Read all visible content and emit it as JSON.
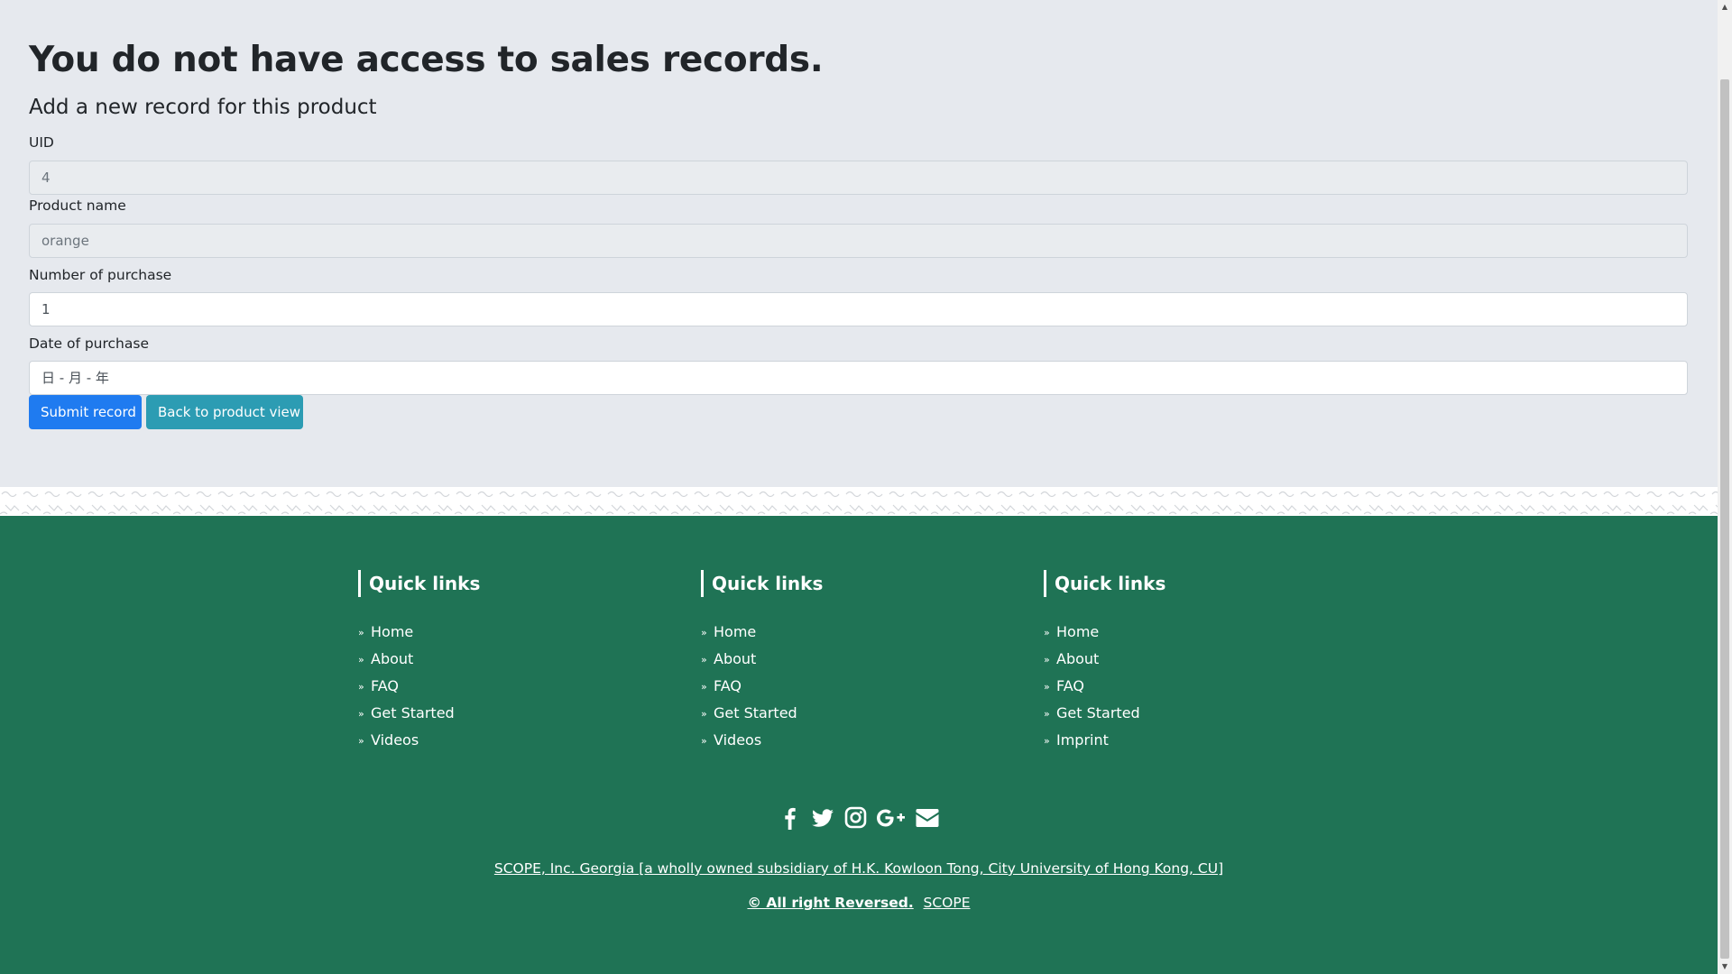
{
  "main": {
    "heading": "You do not have access to sales records.",
    "subheading": "Add a new record for this product",
    "form": {
      "uid_label": "UID",
      "uid_value": "4",
      "product_label": "Product name",
      "product_value": "orange",
      "quantity_label": "Number of purchase",
      "quantity_value": "1",
      "date_label": "Date of purchase",
      "date_value": "日 - 月 - 年",
      "submit_label": "Submit record",
      "back_label": "Back to product view"
    }
  },
  "footer": {
    "columns": [
      {
        "title": "Quick links",
        "links": [
          "Home",
          "About",
          "FAQ",
          "Get Started",
          "Videos"
        ]
      },
      {
        "title": "Quick links",
        "links": [
          "Home",
          "About",
          "FAQ",
          "Get Started",
          "Videos"
        ]
      },
      {
        "title": "Quick links",
        "links": [
          "Home",
          "About",
          "FAQ",
          "Get Started",
          "Imprint"
        ]
      }
    ],
    "social_icons": [
      "facebook-icon",
      "twitter-icon",
      "instagram-icon",
      "google-plus-icon",
      "envelope-icon"
    ],
    "company_text": "SCOPE, Inc. Georgia [a wholly owned subsidiary of H.K. Kowloon Tong, City University of Hong Kong, CU]",
    "copyright_text": "© All right Reversed.",
    "brand_link": "SCOPE"
  },
  "colors": {
    "page_background": "#e6e9ee",
    "footer_background": "#1f7355",
    "primary_button": "#1f7bf0",
    "info_button": "#2c9cb3"
  }
}
